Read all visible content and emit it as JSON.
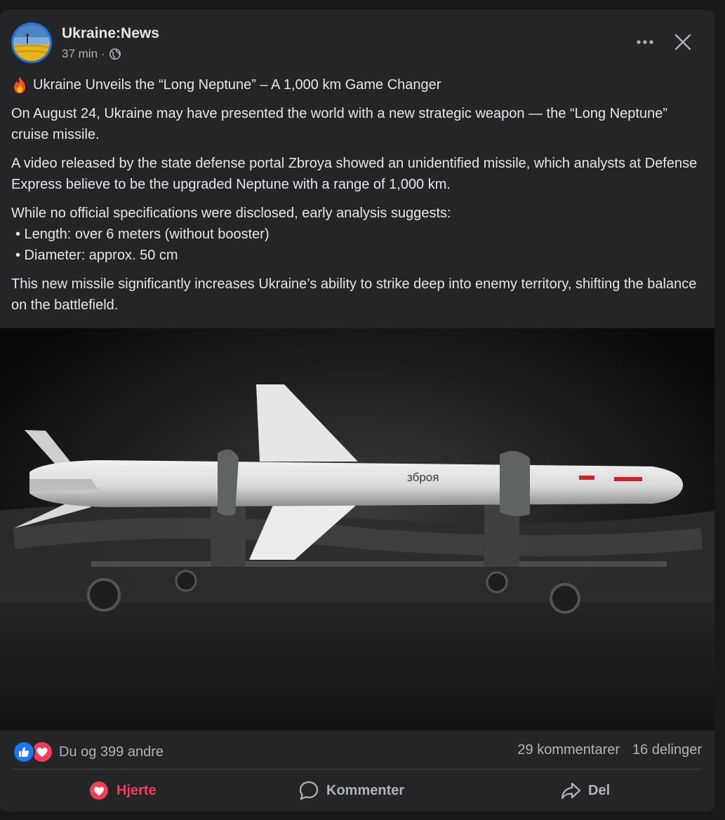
{
  "post": {
    "page_name": "Ukraine:News",
    "time": "37 min",
    "separator": "·",
    "icons": {
      "privacy": "globe-icon",
      "more": "more-dots-icon",
      "close": "close-icon"
    },
    "headline": "Ukraine Unveils the “Long Neptune” – A 1,000 km Game Changer",
    "headline_icon": "fire-emoji",
    "paragraph_1": "On August 24, Ukraine may have presented the world with a new strategic weapon — the “Long Neptune” cruise missile.",
    "paragraph_2": "A video released by the state defense portal Zbroya showed an unidentified missile, which analysts at Defense Express believe to be the upgraded Neptune with a range of 1,000 km.",
    "paragraph_3_intro": "While no official specifications were disclosed, early analysis suggests:",
    "bullets": [
      "• Length: over 6 meters (without booster)",
      "• Diameter: approx. 50 cm"
    ],
    "paragraph_4": "This new missile significantly increases Ukraine’s ability to strike deep into enemy territory, shifting the balance on the battlefield.",
    "image_text": "зброя"
  },
  "engagement": {
    "reactions_text": "Du og 399 andre",
    "comments": "29 kommentarer",
    "shares": "16 delinger",
    "reaction_icons": [
      "like-icon",
      "love-icon"
    ]
  },
  "actions": {
    "like_label": "Hjerte",
    "comment_label": "Kommenter",
    "share_label": "Del"
  },
  "colors": {
    "background": "#18191a",
    "card": "#242526",
    "primary_text": "#e4e6eb",
    "secondary_text": "#b0b3b8",
    "love": "#f33e58",
    "like": "#1877f2"
  }
}
